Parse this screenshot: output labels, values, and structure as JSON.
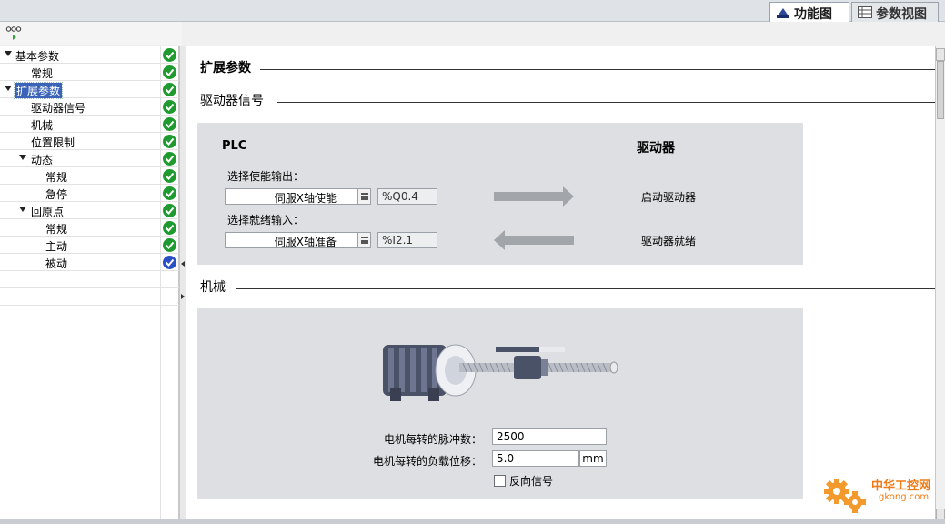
{
  "tabs": {
    "function_view": "功能图",
    "param_view": "参数视图"
  },
  "tree": {
    "items": [
      {
        "label": "基本参数",
        "status": "ok"
      },
      {
        "label": "常规",
        "status": "ok"
      },
      {
        "label": "扩展参数",
        "status": "ok"
      },
      {
        "label": "驱动器信号",
        "status": "ok"
      },
      {
        "label": "机械",
        "status": "ok"
      },
      {
        "label": "位置限制",
        "status": "ok"
      },
      {
        "label": "动态",
        "status": "ok"
      },
      {
        "label": "常规",
        "status": "ok"
      },
      {
        "label": "急停",
        "status": "ok"
      },
      {
        "label": "回原点",
        "status": "ok"
      },
      {
        "label": "常规",
        "status": "ok"
      },
      {
        "label": "主动",
        "status": "ok"
      },
      {
        "label": "被动",
        "status": "info"
      }
    ]
  },
  "main": {
    "title": "扩展参数",
    "drive_signals": {
      "heading": "驱动器信号",
      "plc_label": "PLC",
      "drive_label": "驱动器",
      "enable_output_label": "选择使能输出：",
      "enable_output_value": "伺服X轴使能",
      "enable_output_address": "%Q0.4",
      "ready_input_label": "选择就绪输入：",
      "ready_input_value": "伺服X轴准备",
      "ready_input_address": "%I2.1",
      "enable_drive_text": "启动驱动器",
      "drive_ready_text": "驱动器就绪"
    },
    "mechanics": {
      "heading": "机械",
      "pulses_label": "电机每转的脉冲数：",
      "pulses_value": "2500",
      "displacement_label": "电机每转的负载位移：",
      "displacement_value": "5.0",
      "displacement_unit": "mm",
      "invert_label": "反向信号",
      "invert_checked": false
    }
  },
  "watermark": {
    "name": "中华工控网",
    "url": "gkong.com"
  },
  "colors": {
    "ok": "#1e9a2e",
    "info": "#2a4fc4",
    "selection": "#3b63b8",
    "panel": "#dddfe2",
    "watermark": "#f07a14"
  }
}
